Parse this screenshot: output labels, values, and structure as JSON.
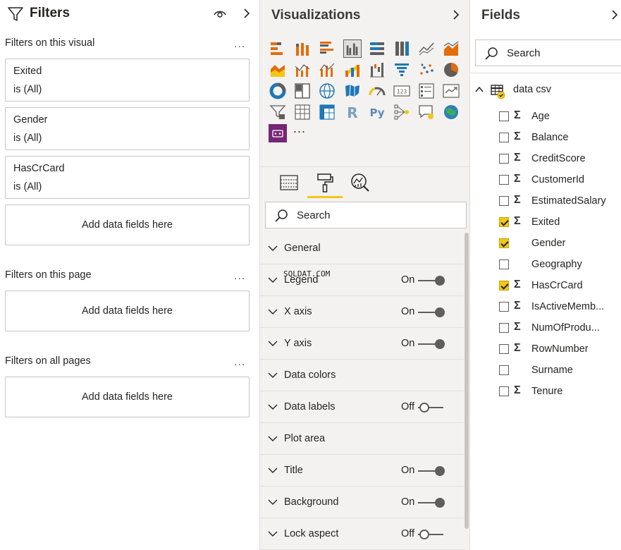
{
  "filters": {
    "title": "Filters",
    "visual_section": {
      "label": "Filters on this visual",
      "more": "..."
    },
    "cards": [
      {
        "name": "Exited",
        "state": "is (All)"
      },
      {
        "name": "Gender",
        "state": "is (All)"
      },
      {
        "name": "HasCrCard",
        "state": "is (All)"
      }
    ],
    "visual_drop": "Add data fields here",
    "page_section": {
      "label": "Filters on this page",
      "more": "...",
      "drop": "Add data fields here"
    },
    "all_section": {
      "label": "Filters on all pages",
      "more": "...",
      "drop": "Add data fields here"
    }
  },
  "visualizations": {
    "title": "Visualizations",
    "more": "...",
    "search_placeholder": "Search",
    "icons": [
      "stacked-bar-chart-icon",
      "stacked-column-chart-icon",
      "clustered-bar-chart-icon",
      "clustered-column-chart-icon",
      "100-stacked-bar-chart-icon",
      "100-stacked-column-chart-icon",
      "line-chart-icon",
      "area-chart-icon",
      "stacked-area-chart-icon",
      "line-clustered-column-icon",
      "line-stacked-column-icon",
      "ribbon-chart-icon",
      "waterfall-chart-icon",
      "funnel-icon",
      "scatter-chart-icon",
      "pie-chart-icon",
      "donut-chart-icon",
      "treemap-icon",
      "map-icon",
      "filled-map-icon",
      "gauge-icon",
      "card-icon",
      "multi-row-card-icon",
      "kpi-icon",
      "slicer-icon",
      "table-icon",
      "matrix-icon",
      "r-visual-icon",
      "python-visual-icon",
      "key-influencers-icon",
      "qa-icon",
      "arcgis-icon",
      "custom-visual-icon"
    ],
    "selected_icon": "clustered-column-chart-icon",
    "format_sections": [
      {
        "label": "General",
        "state": ""
      },
      {
        "label": "Legend",
        "state": "On"
      },
      {
        "label": "X axis",
        "state": "On"
      },
      {
        "label": "Y axis",
        "state": "On"
      },
      {
        "label": "Data colors",
        "state": ""
      },
      {
        "label": "Data labels",
        "state": "Off"
      },
      {
        "label": "Plot area",
        "state": ""
      },
      {
        "label": "Title",
        "state": "On"
      },
      {
        "label": "Background",
        "state": "On"
      },
      {
        "label": "Lock aspect",
        "state": "Off"
      }
    ],
    "watermark": "SQLDAT.COM"
  },
  "fields": {
    "title": "Fields",
    "search_placeholder": "Search",
    "table_name": "data csv",
    "items": [
      {
        "name": "Age",
        "checked": false,
        "sigma": true
      },
      {
        "name": "Balance",
        "checked": false,
        "sigma": true
      },
      {
        "name": "CreditScore",
        "checked": false,
        "sigma": true
      },
      {
        "name": "CustomerId",
        "checked": false,
        "sigma": true
      },
      {
        "name": "EstimatedSalary",
        "checked": false,
        "sigma": true
      },
      {
        "name": "Exited",
        "checked": true,
        "sigma": true
      },
      {
        "name": "Gender",
        "checked": true,
        "sigma": false
      },
      {
        "name": "Geography",
        "checked": false,
        "sigma": false
      },
      {
        "name": "HasCrCard",
        "checked": true,
        "sigma": true
      },
      {
        "name": "IsActiveMemb...",
        "checked": false,
        "sigma": true
      },
      {
        "name": "NumOfProdu...",
        "checked": false,
        "sigma": true
      },
      {
        "name": "RowNumber",
        "checked": false,
        "sigma": true
      },
      {
        "name": "Surname",
        "checked": false,
        "sigma": false
      },
      {
        "name": "Tenure",
        "checked": false,
        "sigma": true
      }
    ]
  },
  "colors": {
    "accent": "#f2c811",
    "pane_bg": "#f3f2f1",
    "border": "#c8c6c4",
    "text": "#252423"
  }
}
